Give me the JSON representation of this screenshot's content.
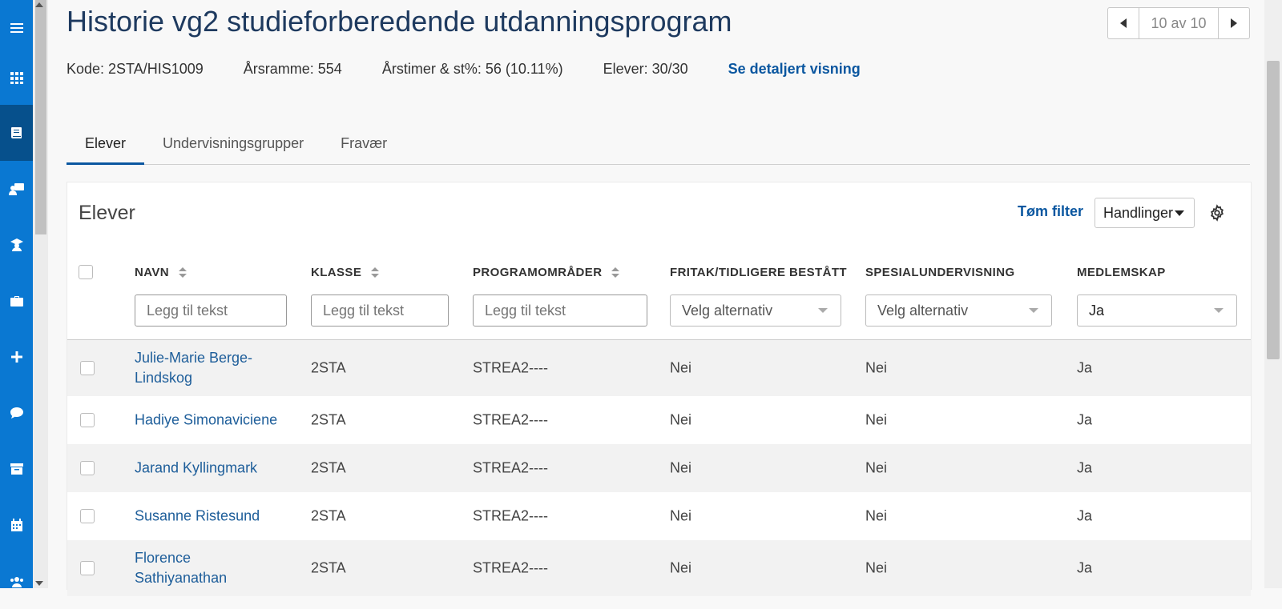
{
  "sidebar": {
    "items": [
      {
        "icon": "menu-icon"
      },
      {
        "icon": "apps-grid-icon"
      },
      {
        "icon": "book-icon"
      },
      {
        "icon": "teacher-board-icon"
      },
      {
        "icon": "graduate-icon"
      },
      {
        "icon": "briefcase-icon"
      },
      {
        "icon": "plus-icon"
      },
      {
        "icon": "chat-icon"
      },
      {
        "icon": "archive-icon"
      },
      {
        "icon": "calendar-icon"
      },
      {
        "icon": "users-icon"
      }
    ],
    "active": "book-icon",
    "accent": "#0a78d2",
    "active_color": "#06508c"
  },
  "header": {
    "title": "Historie vg2 studieforberedende utdanningsprogram",
    "pager_text": "10 av 10"
  },
  "meta": {
    "code": "Kode: 2STA/HIS1009",
    "year_frame": "Årsramme: 554",
    "hours": "Årstimer & st%: 56 (10.11%)",
    "students": "Elever: 30/30",
    "detail_link": "Se detaljert visning"
  },
  "tabs": [
    {
      "label": "Elever",
      "active": true
    },
    {
      "label": "Undervisningsgrupper",
      "active": false
    },
    {
      "label": "Fravær",
      "active": false
    }
  ],
  "panel": {
    "title": "Elever",
    "clear_filter": "Tøm filter",
    "actions": "Handlinger"
  },
  "table": {
    "columns": [
      "NAVN",
      "KLASSE",
      "PROGRAMOMRÅDER",
      "FRITAK/TIDLIGERE BESTÅTT",
      "SPESIALUNDERVISNING",
      "MEDLEMSKAP"
    ],
    "filters": {
      "name_placeholder": "Legg til tekst",
      "class_placeholder": "Legg til tekst",
      "program_placeholder": "Legg til tekst",
      "exemption_value": "Velg alternativ",
      "special_value": "Velg alternativ",
      "membership_value": "Ja"
    },
    "rows": [
      {
        "name": "Julie-Marie Berge-Lindskog",
        "class": "2STA",
        "program": "STREA2----",
        "exemption": "Nei",
        "special": "Nei",
        "membership": "Ja"
      },
      {
        "name": "Hadiye Simonaviciene",
        "class": "2STA",
        "program": "STREA2----",
        "exemption": "Nei",
        "special": "Nei",
        "membership": "Ja"
      },
      {
        "name": "Jarand Kyllingmark",
        "class": "2STA",
        "program": "STREA2----",
        "exemption": "Nei",
        "special": "Nei",
        "membership": "Ja"
      },
      {
        "name": "Susanne Ristesund",
        "class": "2STA",
        "program": "STREA2----",
        "exemption": "Nei",
        "special": "Nei",
        "membership": "Ja"
      },
      {
        "name": "Florence Sathiyanathan",
        "class": "2STA",
        "program": "STREA2----",
        "exemption": "Nei",
        "special": "Nei",
        "membership": "Ja"
      }
    ]
  }
}
